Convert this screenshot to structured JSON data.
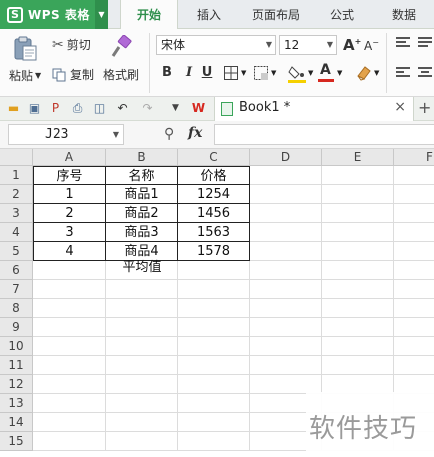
{
  "app": {
    "name": "WPS 表格",
    "logo": "S",
    "brand_color": "#3aa55a"
  },
  "menu": {
    "tabs": [
      "开始",
      "插入",
      "页面布局",
      "公式",
      "数据"
    ],
    "active_tab": "开始"
  },
  "ribbon": {
    "paste_label": "粘贴",
    "cut_label": "剪切",
    "copy_label": "复制",
    "format_painter_label": "格式刷",
    "font_name": "宋体",
    "font_size": "12",
    "bold": "B",
    "italic": "I",
    "underline": "U",
    "font_color_accent": "#d6281f",
    "fill_color_accent": "#f5d000"
  },
  "document": {
    "tab_title": "Book1 *"
  },
  "formula_bar": {
    "cell_ref": "J23",
    "fx": "fx",
    "formula": ""
  },
  "sheet": {
    "columns": [
      "A",
      "B",
      "C",
      "D",
      "E",
      "F"
    ],
    "rows": [
      "1",
      "2",
      "3",
      "4",
      "5",
      "6",
      "7",
      "8",
      "9",
      "10",
      "11",
      "12",
      "13",
      "14",
      "15"
    ],
    "table": {
      "headers": [
        "序号",
        "名称",
        "价格"
      ],
      "rows": [
        [
          "1",
          "商品1",
          "1254"
        ],
        [
          "2",
          "商品2",
          "1456"
        ],
        [
          "3",
          "商品3",
          "1563"
        ],
        [
          "4",
          "商品4",
          "1578"
        ]
      ],
      "footer_label": "平均值"
    }
  },
  "watermark": {
    "text": "软件技巧"
  }
}
